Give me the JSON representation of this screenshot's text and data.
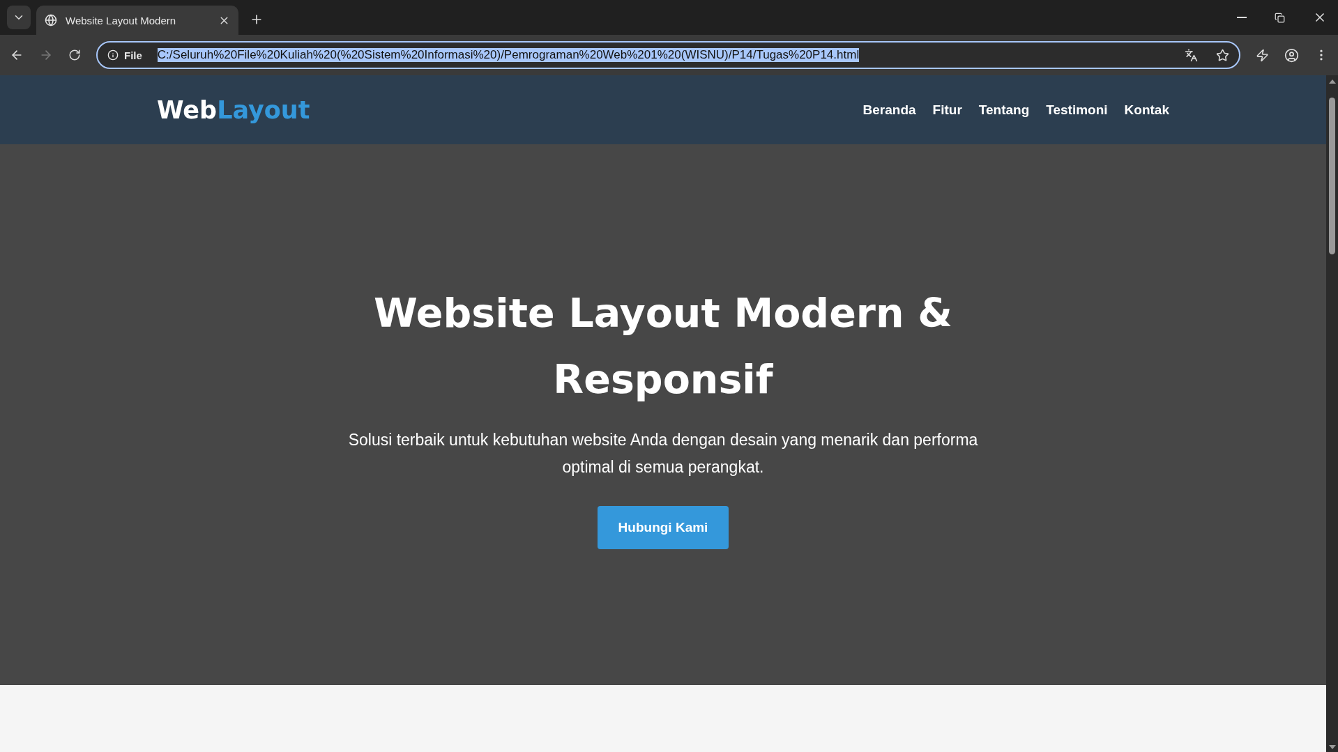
{
  "browser": {
    "tab": {
      "title": "Website Layout Modern"
    },
    "address": {
      "scheme_label": "File",
      "url": "C:/Seluruh%20File%20Kuliah%20(%20Sistem%20Informasi%20)/Pemrograman%20Web%201%20(WISNU)/P14/Tugas%20P14.html"
    }
  },
  "header": {
    "logo": {
      "text": "Web",
      "accent": "Layout"
    },
    "nav": [
      "Beranda",
      "Fitur",
      "Tentang",
      "Testimoni",
      "Kontak"
    ]
  },
  "hero": {
    "title": "Website Layout Modern & Responsif",
    "subtitle": "Solusi terbaik untuk kebutuhan website Anda dengan desain yang menarik dan performa optimal di semua perangkat.",
    "button": "Hubungi Kami"
  }
}
